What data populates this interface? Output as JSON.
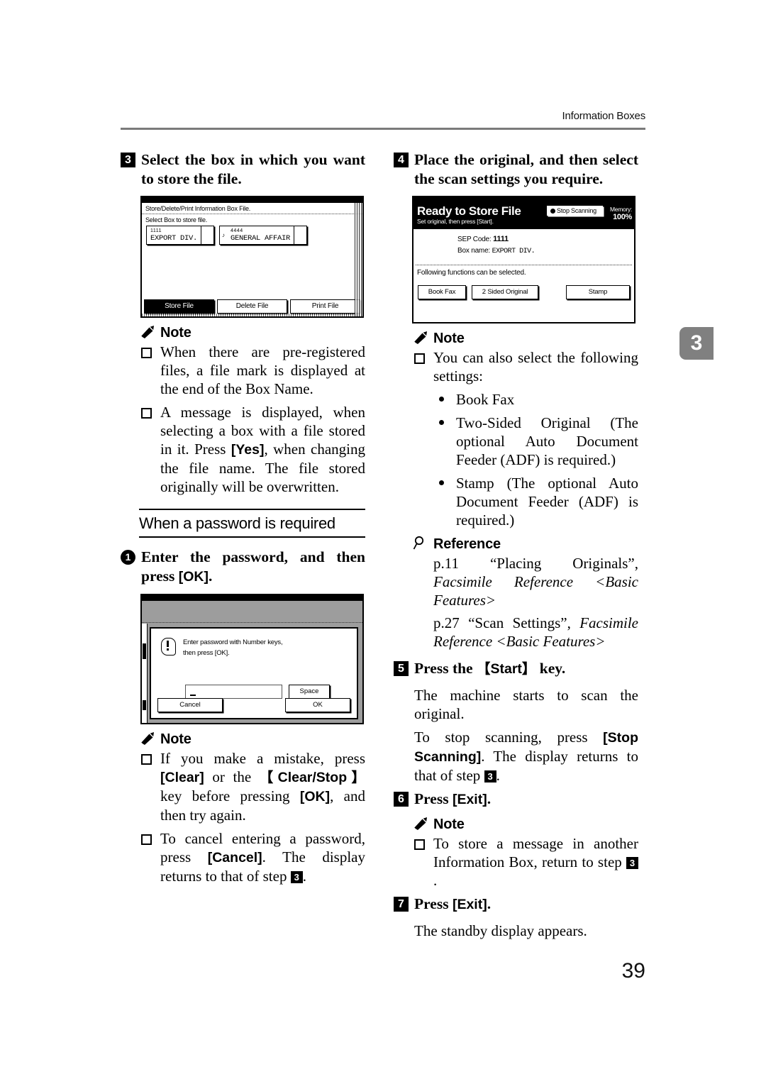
{
  "page": {
    "running_head": "Information Boxes",
    "page_number": "39",
    "chapter_tab": "3"
  },
  "left_column": {
    "step3": {
      "number": "3",
      "heading": "Select the box in which you want to store the file."
    },
    "figure1": {
      "title": "Store/Delete/Print Information Box File.",
      "subtitle": "Select Box to store file.",
      "boxes": [
        {
          "code": "1111",
          "name": "EXPORT DIV.",
          "mark": ""
        },
        {
          "code": "4444",
          "name": "GENERAL AFFAIR",
          "mark": "♪"
        }
      ],
      "buttons": [
        {
          "label": "Store File",
          "selected": true
        },
        {
          "label": "Delete File",
          "selected": false
        },
        {
          "label": "Print File",
          "selected": false
        }
      ]
    },
    "note1": {
      "heading": "Note",
      "items": [
        "When there are pre-registered files, a file mark is displayed at the end of the Box Name.",
        "A message is displayed, when selecting a box with a file stored in it. Press "
      ],
      "item2_bold": "[Yes]",
      "item2_rest": ", when changing the file name. The file stored originally will be overwritten."
    },
    "section_heading": "When a password is required",
    "step1": {
      "number": "1",
      "heading_a": "Enter the password, and then press ",
      "heading_b": "[OK]",
      "heading_c": "."
    },
    "figure3": {
      "message_line1": "Enter password with Number keys,",
      "message_line2": "then press [OK].",
      "field_value": "",
      "space_label": "Space",
      "cancel_label": "Cancel",
      "ok_label": "OK"
    },
    "note2": {
      "heading": "Note",
      "item1_a": "If you make a mistake, press ",
      "item1_b": "[Clear]",
      "item1_c": " or the ",
      "item1_d": "【Clear/Stop】",
      "item1_e": " key before pressing ",
      "item1_f": "[OK]",
      "item1_g": ", and then try again.",
      "item2_a": "To cancel entering a password, press ",
      "item2_b": "[Cancel]",
      "item2_c": ". The display returns to that of step ",
      "item2_step": "3",
      "item2_d": "."
    }
  },
  "right_column": {
    "step4": {
      "number": "4",
      "heading": "Place the original, and then select the scan settings you require."
    },
    "figure2": {
      "title": "Ready to Store File",
      "subtitle": "Set original, then press [Start].",
      "stop_button": "Stop Scanning",
      "memory_label": "Memory:",
      "memory_value": "100%",
      "sep_code_label": "SEP Code:",
      "sep_code_value": "1111",
      "box_name_label": "Box name:",
      "box_name_value": "EXPORT DIV.",
      "functions_note": "Following functions can be selected.",
      "buttons": [
        "Book Fax",
        "2 Sided Original",
        "Stamp"
      ]
    },
    "note3": {
      "heading": "Note",
      "item1": "You can also select the following settings:",
      "subitems": [
        "Book Fax",
        "Two-Sided Original (The optional Auto Document Feeder (ADF) is required.)",
        "Stamp (The optional Auto Document Feeder (ADF) is required.)"
      ]
    },
    "reference": {
      "heading": "Reference",
      "item1_plain": "p.11 “Placing Originals”, ",
      "item1_italic": "Facsimile Reference <Basic Features>",
      "item2_plain": "p.27 “Scan Settings”, ",
      "item2_italic": "Facsimile Reference <Basic Features>"
    },
    "step5": {
      "number": "5",
      "heading_a": "Press the ",
      "heading_b": "【Start】",
      "heading_c": " key.",
      "para1": "The machine starts to scan the original.",
      "para2_a": "To stop scanning, press ",
      "para2_b": "[Stop Scanning]",
      "para2_c": ". The display returns to that of step ",
      "para2_step": "3",
      "para2_d": "."
    },
    "step6": {
      "number": "6",
      "heading_a": "Press ",
      "heading_b": "[Exit]",
      "heading_c": "."
    },
    "note4": {
      "heading": "Note",
      "item1_a": "To store a message in another Information Box, return to step ",
      "item1_step": "3",
      "item1_b": "."
    },
    "step7": {
      "number": "7",
      "heading_a": "Press ",
      "heading_b": "[Exit]",
      "heading_c": ".",
      "para1": "The standby display appears."
    }
  }
}
